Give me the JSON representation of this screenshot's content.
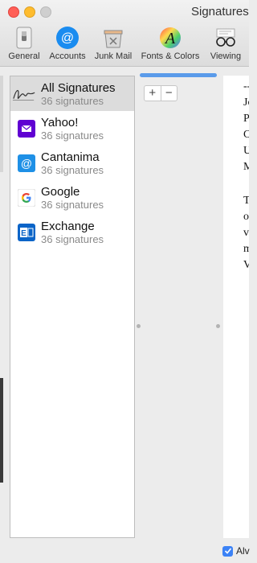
{
  "window": {
    "title": "Signatures"
  },
  "toolbar": [
    {
      "label": "General",
      "icon": "general-switch-icon"
    },
    {
      "label": "Accounts",
      "icon": "accounts-at-icon"
    },
    {
      "label": "Junk Mail",
      "icon": "junk-mail-icon"
    },
    {
      "label": "Fonts & Colors",
      "icon": "fonts-colors-icon"
    },
    {
      "label": "Viewing",
      "icon": "viewing-glasses-icon"
    }
  ],
  "accounts": [
    {
      "name": "All Signatures",
      "count": "36 signatures",
      "icon": "signature-icon",
      "selected": true
    },
    {
      "name": "Yahoo!",
      "count": "36 signatures",
      "icon": "yahoo-mail-icon",
      "color": "#6001d2"
    },
    {
      "name": "Cantanima",
      "count": "36 signatures",
      "icon": "at-sign-icon",
      "color": "#1e90e6"
    },
    {
      "name": "Google",
      "count": "36 signatures",
      "icon": "google-g-icon"
    },
    {
      "name": "Exchange",
      "count": "36 signatures",
      "icon": "exchange-icon",
      "color": "#0a64c8"
    }
  ],
  "signature_list": {
    "add_label": "+",
    "remove_label": "−"
  },
  "preview_lines": [
    "--",
    "Jo",
    "P",
    "C",
    "U",
    "M",
    "",
    "T",
    "o",
    "v",
    "m",
    "V"
  ],
  "options": {
    "always_match_label": "Alv"
  },
  "colors": {
    "accent": "#3b82f6",
    "progress": "#5a9bea"
  }
}
